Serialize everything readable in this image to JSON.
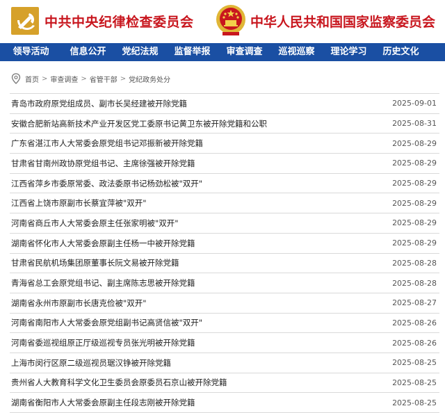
{
  "header": {
    "title_left": "中共中央纪律检查委员会",
    "title_right": "中华人民共和国国家监察委员会",
    "brand_color": "#c8161e",
    "left_emblem": "party-emblem-icon",
    "right_emblem": "national-emblem-icon"
  },
  "nav": {
    "background": "#1a4fa3",
    "items": [
      "领导活动",
      "信息公开",
      "党纪法规",
      "监督举报",
      "审查调查",
      "巡视巡察",
      "理论学习",
      "历史文化"
    ]
  },
  "breadcrumb": {
    "icon": "location-pin-icon",
    "items": [
      "首页",
      "审查调查",
      "省管干部",
      "党纪政务处分"
    ],
    "separator": ">"
  },
  "articles": [
    {
      "title": "青岛市政府原党组成员、副市长吴经建被开除党籍",
      "date": "2025-09-01"
    },
    {
      "title": "安徽合肥新站高新技术产业开发区党工委原书记黄卫东被开除党籍和公职",
      "date": "2025-08-31"
    },
    {
      "title": "广东省湛江市人大常委会原党组书记邓振新被开除党籍",
      "date": "2025-08-29"
    },
    {
      "title": "甘肃省甘南州政协原党组书记、主席徐强被开除党籍",
      "date": "2025-08-29"
    },
    {
      "title": "江西省萍乡市委原常委、政法委原书记杨劲松被\"双开\"",
      "date": "2025-08-29"
    },
    {
      "title": "江西省上饶市原副市长蔡宜萍被\"双开\"",
      "date": "2025-08-29"
    },
    {
      "title": "河南省商丘市人大常委会原主任张家明被\"双开\"",
      "date": "2025-08-29"
    },
    {
      "title": "湖南省怀化市人大常委会原副主任杨一中被开除党籍",
      "date": "2025-08-29"
    },
    {
      "title": "甘肃省民航机场集团原董事长阮文易被开除党籍",
      "date": "2025-08-28"
    },
    {
      "title": "青海省总工会原党组书记、副主席陈志思被开除党籍",
      "date": "2025-08-28"
    },
    {
      "title": "湖南省永州市原副市长唐克俭被\"双开\"",
      "date": "2025-08-27"
    },
    {
      "title": "河南省南阳市人大常委会原党组副书记高贤信被\"双开\"",
      "date": "2025-08-26"
    },
    {
      "title": "河南省委巡视组原正厅级巡视专员张光明被开除党籍",
      "date": "2025-08-26"
    },
    {
      "title": "上海市闵行区原二级巡视员琚汉铮被开除党籍",
      "date": "2025-08-25"
    },
    {
      "title": "贵州省人大教育科学文化卫生委员会原委员石京山被开除党籍",
      "date": "2025-08-25"
    },
    {
      "title": "湖南省衡阳市人大常委会原副主任段志刚被开除党籍",
      "date": "2025-08-25"
    }
  ]
}
